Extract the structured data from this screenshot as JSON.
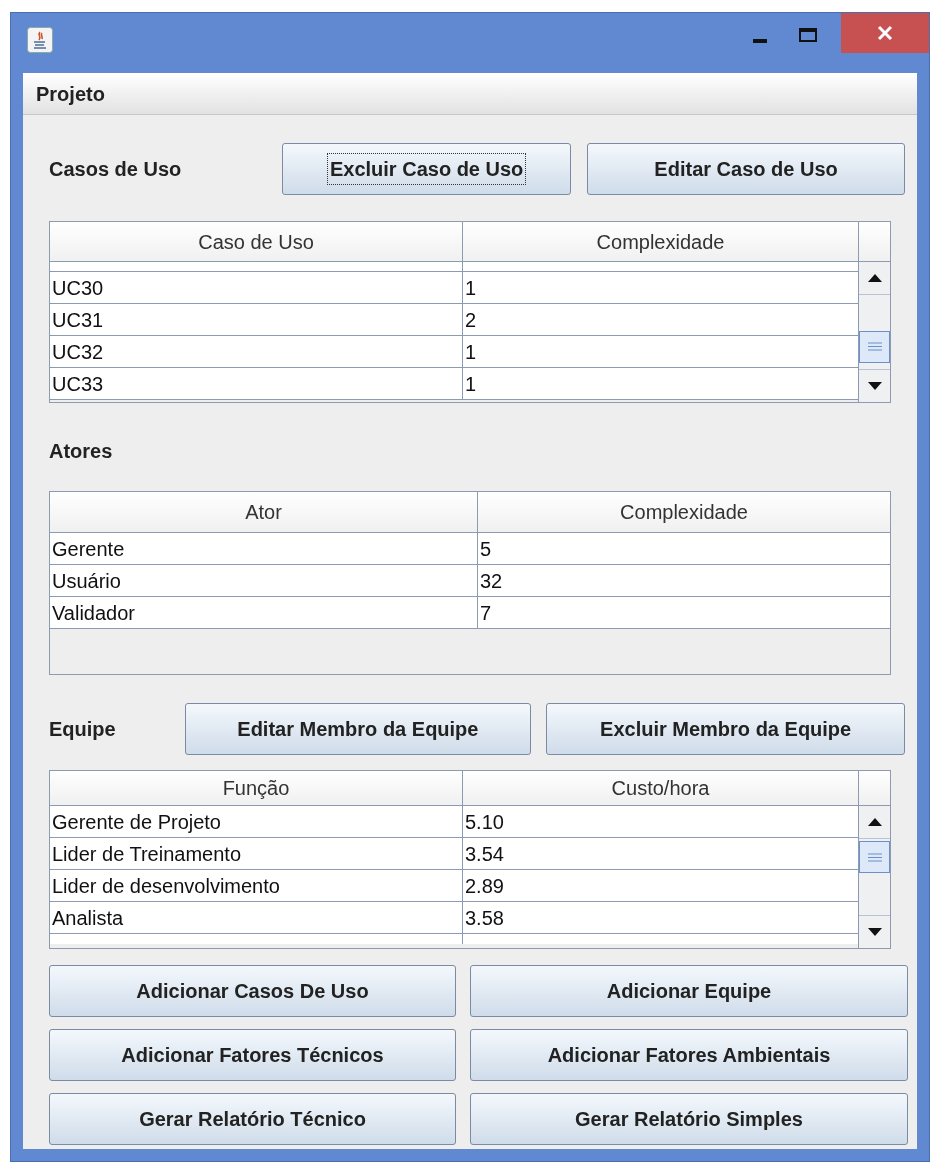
{
  "menu": [
    "Projeto"
  ],
  "use_cases": {
    "label": "Casos de Uso",
    "buttons": [
      {
        "label": "Excluir Caso de Uso",
        "focused": true
      },
      {
        "label": "Editar Caso de Uso",
        "focused": false
      }
    ],
    "columns": [
      "Caso de Uso",
      "Complexidade"
    ],
    "rows": [
      [
        "UC30",
        "1"
      ],
      [
        "UC31",
        "2"
      ],
      [
        "UC32",
        "1"
      ],
      [
        "UC33",
        "1"
      ]
    ]
  },
  "actors": {
    "label": "Atores",
    "columns": [
      "Ator",
      "Complexidade"
    ],
    "rows": [
      [
        "Gerente",
        "5"
      ],
      [
        "Usuário",
        "32"
      ],
      [
        "Validador",
        "7"
      ]
    ]
  },
  "team": {
    "label": "Equipe",
    "buttons": [
      {
        "label": "Editar Membro da Equipe",
        "focused": false
      },
      {
        "label": "Excluir Membro da Equipe",
        "focused": false
      }
    ],
    "columns": [
      "Função",
      "Custo/hora"
    ],
    "rows": [
      [
        "Gerente de Projeto",
        "5.10"
      ],
      [
        "Lider de Treinamento",
        "3.54"
      ],
      [
        "Lider de desenvolvimento",
        "2.89"
      ],
      [
        "Analista",
        "3.58"
      ]
    ]
  },
  "actions": [
    {
      "label": "Adicionar Casos De Uso",
      "focused": false
    },
    {
      "label": "Adicionar Equipe",
      "focused": false
    },
    {
      "label": "Adicionar Fatores Técnicos",
      "focused": false
    },
    {
      "label": "Adicionar Fatores Ambientais",
      "focused": false
    },
    {
      "label": "Gerar Relatório Técnico",
      "focused": false
    },
    {
      "label": "Gerar Relatório Simples",
      "focused": false
    }
  ]
}
